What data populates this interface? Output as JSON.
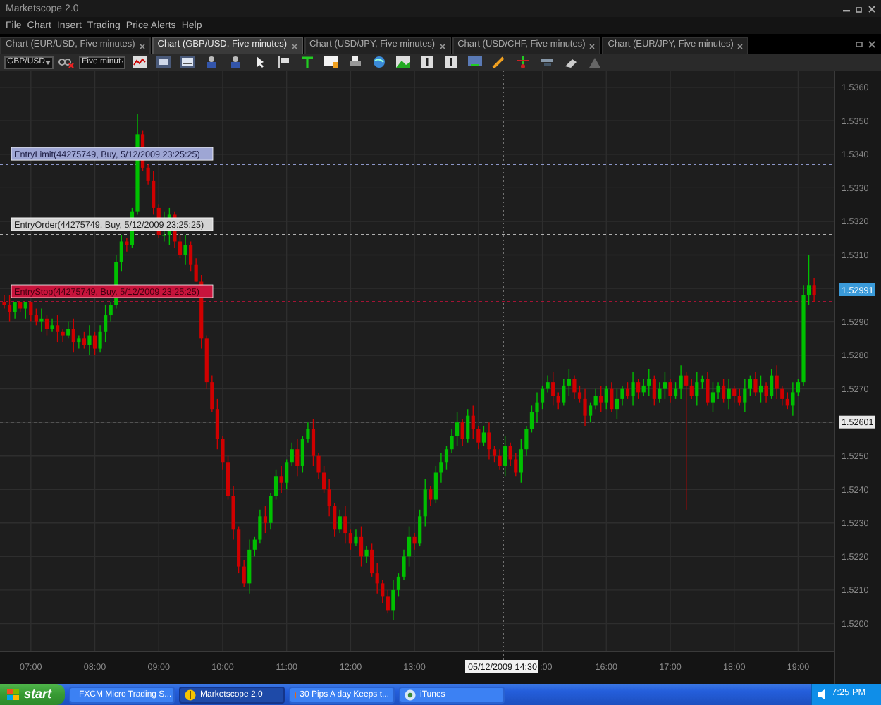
{
  "window": {
    "title": "Marketscope 2.0"
  },
  "menu": [
    "File",
    "Chart",
    "Insert",
    "Trading",
    "Price Alerts",
    "Help"
  ],
  "tabs": [
    {
      "label": "Chart (EUR/USD, Five minutes)",
      "selected": false
    },
    {
      "label": "Chart (GBP/USD, Five minutes)",
      "selected": true
    },
    {
      "label": "Chart (USD/JPY, Five minutes)",
      "selected": false
    },
    {
      "label": "Chart (USD/CHF, Five minutes)",
      "selected": false
    },
    {
      "label": "Chart (EUR/JPY, Five minutes)",
      "selected": false
    }
  ],
  "toolbar": {
    "symbol": "GBP/USD",
    "timeframe": "Five minut"
  },
  "chart": {
    "time_fragment": ":00",
    "orders": [
      {
        "kind": "limit",
        "label": "EntryLimit(44275749, Buy, 5/12/2009 23:25:25)"
      },
      {
        "kind": "order",
        "label": "EntryOrder(44275749, Buy, 5/12/2009 23:25:25)"
      },
      {
        "kind": "stop",
        "label": "EntryStop(44275749, Buy, 5/12/2009 23:25:25)"
      }
    ],
    "chart_data": {
      "type": "candlestick",
      "grid": true,
      "ylim": [
        1.5182,
        1.5365
      ],
      "ref_lines": [
        {
          "axis": "y",
          "value": 1.5337,
          "color": "#8c96c8"
        },
        {
          "axis": "y",
          "value": 1.5316,
          "color": "#e0e0e0"
        },
        {
          "axis": "y",
          "value": 1.5296,
          "color": "#d0103c"
        },
        {
          "axis": "y",
          "value": 1.52601,
          "color": "#777777",
          "label": "1.52601"
        }
      ],
      "yticks": [
        {
          "value": 1.536,
          "label": "1.5360"
        },
        {
          "value": 1.535,
          "label": "1.5350"
        },
        {
          "value": 1.534,
          "label": "1.5340"
        },
        {
          "value": 1.533,
          "label": "1.5330"
        },
        {
          "value": 1.532,
          "label": "1.5320"
        },
        {
          "value": 1.531,
          "label": "1.5310"
        },
        {
          "value": 1.529,
          "label": "1.5290"
        },
        {
          "value": 1.528,
          "label": "1.5280"
        },
        {
          "value": 1.527,
          "label": "1.5270"
        },
        {
          "value": 1.525,
          "label": "1.5250"
        },
        {
          "value": 1.524,
          "label": "1.5240"
        },
        {
          "value": 1.523,
          "label": "1.5230"
        },
        {
          "value": 1.522,
          "label": "1.5220"
        },
        {
          "value": 1.521,
          "label": "1.5210"
        },
        {
          "value": 1.52,
          "label": "1.5200"
        }
      ],
      "categories": [
        null,
        null,
        null,
        null,
        null,
        "07:00",
        null,
        null,
        null,
        null,
        null,
        null,
        null,
        null,
        null,
        null,
        null,
        "08:00",
        null,
        null,
        null,
        null,
        null,
        null,
        null,
        null,
        null,
        null,
        null,
        "09:00",
        null,
        null,
        null,
        null,
        null,
        null,
        null,
        null,
        null,
        null,
        null,
        "10:00",
        null,
        null,
        null,
        null,
        null,
        null,
        null,
        null,
        null,
        null,
        null,
        "11:00",
        null,
        null,
        null,
        null,
        null,
        null,
        null,
        null,
        null,
        null,
        null,
        "12:00",
        null,
        null,
        null,
        null,
        null,
        null,
        null,
        null,
        null,
        null,
        null,
        "13:00",
        null,
        null,
        null,
        null,
        null,
        null,
        null,
        null,
        null,
        null,
        null,
        null,
        null,
        null,
        null,
        null,
        null,
        null,
        null,
        null,
        null,
        null,
        null,
        null,
        null,
        null,
        null,
        null,
        null,
        null,
        null,
        null,
        null,
        null,
        null,
        "16:00",
        null,
        null,
        null,
        null,
        null,
        null,
        null,
        null,
        null,
        null,
        null,
        "17:00",
        null,
        null,
        null,
        null,
        null,
        null,
        null,
        null,
        null,
        null,
        null,
        "18:00",
        null,
        null,
        null,
        null,
        null,
        null,
        null,
        null,
        null,
        null,
        null,
        "19:00",
        null,
        null,
        null
      ],
      "ohlc": [
        [
          1.5296,
          1.5298,
          1.5294,
          1.5295
        ],
        [
          1.5295,
          1.5298,
          1.529,
          1.5293
        ],
        [
          1.5293,
          1.5296,
          1.5291,
          1.5296
        ],
        [
          1.5296,
          1.5296,
          1.5293,
          1.5294
        ],
        [
          1.5294,
          1.5296,
          1.5291,
          1.5296
        ],
        [
          1.5296,
          1.5296,
          1.529,
          1.5292
        ],
        [
          1.5292,
          1.5294,
          1.5289,
          1.529
        ],
        [
          1.529,
          1.5294,
          1.5287,
          1.5291
        ],
        [
          1.5291,
          1.5292,
          1.5286,
          1.5288
        ],
        [
          1.5288,
          1.5291,
          1.5287,
          1.5289
        ],
        [
          1.5289,
          1.5292,
          1.5284,
          1.5287
        ],
        [
          1.5287,
          1.5288,
          1.5284,
          1.5286
        ],
        [
          1.5286,
          1.529,
          1.5285,
          1.5288
        ],
        [
          1.5288,
          1.5291,
          1.5281,
          1.5284
        ],
        [
          1.5284,
          1.5286,
          1.5282,
          1.5285
        ],
        [
          1.5285,
          1.5287,
          1.5282,
          1.5283
        ],
        [
          1.5283,
          1.5289,
          1.528,
          1.5286
        ],
        [
          1.5286,
          1.5287,
          1.528,
          1.5282
        ],
        [
          1.5282,
          1.5289,
          1.5281,
          1.5287
        ],
        [
          1.5287,
          1.5295,
          1.5284,
          1.5292
        ],
        [
          1.5292,
          1.5296,
          1.529,
          1.5295
        ],
        [
          1.5295,
          1.531,
          1.5294,
          1.5308
        ],
        [
          1.5308,
          1.5316,
          1.5305,
          1.5314
        ],
        [
          1.5314,
          1.5315,
          1.5311,
          1.5313
        ],
        [
          1.5313,
          1.5324,
          1.5312,
          1.5323
        ],
        [
          1.5323,
          1.5352,
          1.5322,
          1.5346
        ],
        [
          1.5346,
          1.5347,
          1.5335,
          1.5336
        ],
        [
          1.5336,
          1.5337,
          1.5331,
          1.5332
        ],
        [
          1.5332,
          1.5335,
          1.5322,
          1.5324
        ],
        [
          1.5324,
          1.5325,
          1.5315,
          1.5316
        ],
        [
          1.5316,
          1.5323,
          1.5314,
          1.5316
        ],
        [
          1.5316,
          1.5324,
          1.5313,
          1.5322
        ],
        [
          1.5322,
          1.5323,
          1.5312,
          1.5314
        ],
        [
          1.5314,
          1.5316,
          1.5309,
          1.531
        ],
        [
          1.531,
          1.5316,
          1.5307,
          1.5313
        ],
        [
          1.5313,
          1.5314,
          1.5305,
          1.5307
        ],
        [
          1.5307,
          1.5309,
          1.5302,
          1.5302
        ],
        [
          1.5302,
          1.5304,
          1.5282,
          1.5285
        ],
        [
          1.5285,
          1.5286,
          1.527,
          1.5272
        ],
        [
          1.5272,
          1.5274,
          1.5263,
          1.5264
        ],
        [
          1.5264,
          1.5267,
          1.5252,
          1.5255
        ],
        [
          1.5255,
          1.5256,
          1.5246,
          1.5248
        ],
        [
          1.5248,
          1.525,
          1.5237,
          1.5238
        ],
        [
          1.5238,
          1.5241,
          1.5225,
          1.5228
        ],
        [
          1.5228,
          1.5229,
          1.5215,
          1.5217
        ],
        [
          1.5217,
          1.5219,
          1.5211,
          1.5212
        ],
        [
          1.5212,
          1.5225,
          1.5209,
          1.5222
        ],
        [
          1.5222,
          1.5226,
          1.522,
          1.5225
        ],
        [
          1.5225,
          1.5234,
          1.5224,
          1.5232
        ],
        [
          1.5232,
          1.5235,
          1.5227,
          1.523
        ],
        [
          1.523,
          1.5239,
          1.5228,
          1.5238
        ],
        [
          1.5238,
          1.5246,
          1.5237,
          1.5244
        ],
        [
          1.5244,
          1.5247,
          1.5239,
          1.5242
        ],
        [
          1.5242,
          1.5249,
          1.524,
          1.5248
        ],
        [
          1.5248,
          1.5254,
          1.5247,
          1.5252
        ],
        [
          1.5252,
          1.5255,
          1.5244,
          1.5247
        ],
        [
          1.5247,
          1.5256,
          1.5245,
          1.5255
        ],
        [
          1.5255,
          1.526,
          1.5254,
          1.5258
        ],
        [
          1.5258,
          1.5261,
          1.5247,
          1.525
        ],
        [
          1.525,
          1.5251,
          1.5243,
          1.5245
        ],
        [
          1.5245,
          1.5247,
          1.5239,
          1.524
        ],
        [
          1.524,
          1.5243,
          1.5232,
          1.5235
        ],
        [
          1.5235,
          1.5236,
          1.5226,
          1.5228
        ],
        [
          1.5228,
          1.5234,
          1.5227,
          1.5232
        ],
        [
          1.5232,
          1.5235,
          1.5224,
          1.5227
        ],
        [
          1.5227,
          1.5228,
          1.5222,
          1.5224
        ],
        [
          1.5224,
          1.5228,
          1.5223,
          1.5226
        ],
        [
          1.5226,
          1.5229,
          1.5217,
          1.522
        ],
        [
          1.522,
          1.5223,
          1.5218,
          1.5222
        ],
        [
          1.5222,
          1.5224,
          1.5214,
          1.5215
        ],
        [
          1.5215,
          1.5218,
          1.5209,
          1.5212
        ],
        [
          1.5212,
          1.5213,
          1.5206,
          1.5208
        ],
        [
          1.5208,
          1.521,
          1.5203,
          1.5204
        ],
        [
          1.5204,
          1.5213,
          1.5201,
          1.521
        ],
        [
          1.521,
          1.5215,
          1.5208,
          1.5214
        ],
        [
          1.5214,
          1.5222,
          1.5213,
          1.522
        ],
        [
          1.522,
          1.5229,
          1.5217,
          1.5226
        ],
        [
          1.5226,
          1.5227,
          1.5222,
          1.5224
        ],
        [
          1.5224,
          1.5234,
          1.5223,
          1.5232
        ],
        [
          1.5232,
          1.5243,
          1.5229,
          1.524
        ],
        [
          1.524,
          1.5241,
          1.5235,
          1.5237
        ],
        [
          1.5237,
          1.5247,
          1.5236,
          1.5245
        ],
        [
          1.5245,
          1.5251,
          1.5242,
          1.5248
        ],
        [
          1.5248,
          1.5253,
          1.5246,
          1.5252
        ],
        [
          1.5252,
          1.5258,
          1.5251,
          1.5256
        ],
        [
          1.5256,
          1.5263,
          1.5253,
          1.526
        ],
        [
          1.526,
          1.5261,
          1.5253,
          1.5255
        ],
        [
          1.5255,
          1.5264,
          1.5254,
          1.5262
        ],
        [
          1.5262,
          1.5265,
          1.5255,
          1.5258
        ],
        [
          1.5258,
          1.5259,
          1.5252,
          1.5254
        ],
        [
          1.5254,
          1.5259,
          1.5253,
          1.5257
        ],
        [
          1.5257,
          1.526,
          1.5249,
          1.5252
        ],
        [
          1.5252,
          1.5253,
          1.5248,
          1.525
        ],
        [
          1.525,
          1.5252,
          1.5246,
          1.5247
        ],
        [
          1.5247,
          1.5256,
          1.5244,
          1.5253
        ],
        [
          1.5253,
          1.5254,
          1.5247,
          1.5249
        ],
        [
          1.5249,
          1.5251,
          1.5244,
          1.5245
        ],
        [
          1.5245,
          1.5255,
          1.5242,
          1.5252
        ],
        [
          1.5252,
          1.5259,
          1.525,
          1.5258
        ],
        [
          1.5258,
          1.5265,
          1.5257,
          1.5263
        ],
        [
          1.5263,
          1.5269,
          1.526,
          1.5266
        ],
        [
          1.5266,
          1.5271,
          1.5264,
          1.527
        ],
        [
          1.527,
          1.5274,
          1.5269,
          1.5272
        ],
        [
          1.5272,
          1.5275,
          1.5265,
          1.5268
        ],
        [
          1.5268,
          1.5269,
          1.5264,
          1.5266
        ],
        [
          1.5266,
          1.5273,
          1.5265,
          1.5271
        ],
        [
          1.5271,
          1.5276,
          1.5268,
          1.5273
        ],
        [
          1.5273,
          1.5274,
          1.5267,
          1.5269
        ],
        [
          1.5269,
          1.5271,
          1.5266,
          1.5267
        ],
        [
          1.5267,
          1.527,
          1.5259,
          1.5262
        ],
        [
          1.5262,
          1.5266,
          1.526,
          1.5265
        ],
        [
          1.5265,
          1.527,
          1.5264,
          1.5268
        ],
        [
          1.5268,
          1.5271,
          1.5263,
          1.5266
        ],
        [
          1.5266,
          1.5271,
          1.5264,
          1.527
        ],
        [
          1.527,
          1.5272,
          1.5263,
          1.5264
        ],
        [
          1.5264,
          1.527,
          1.5261,
          1.5267
        ],
        [
          1.5267,
          1.5271,
          1.5265,
          1.527
        ],
        [
          1.527,
          1.5272,
          1.5267,
          1.5268
        ],
        [
          1.5268,
          1.5275,
          1.5265,
          1.5272
        ],
        [
          1.5272,
          1.5273,
          1.5267,
          1.5269
        ],
        [
          1.5269,
          1.5273,
          1.5268,
          1.5271
        ],
        [
          1.5271,
          1.5276,
          1.5268,
          1.5273
        ],
        [
          1.5273,
          1.5274,
          1.5265,
          1.5267
        ],
        [
          1.5267,
          1.5272,
          1.5266,
          1.527
        ],
        [
          1.527,
          1.5275,
          1.5267,
          1.5272
        ],
        [
          1.5272,
          1.5273,
          1.5266,
          1.5268
        ],
        [
          1.5268,
          1.5272,
          1.5267,
          1.527
        ],
        [
          1.527,
          1.5277,
          1.5267,
          1.5274
        ],
        [
          1.5274,
          1.5275,
          1.5234,
          1.5271
        ],
        [
          1.5271,
          1.5273,
          1.5267,
          1.5268
        ],
        [
          1.5268,
          1.5275,
          1.5265,
          1.5272
        ],
        [
          1.5272,
          1.5274,
          1.527,
          1.5273
        ],
        [
          1.5273,
          1.5275,
          1.5265,
          1.5266
        ],
        [
          1.5266,
          1.5272,
          1.5263,
          1.5269
        ],
        [
          1.5269,
          1.5272,
          1.5267,
          1.5271
        ],
        [
          1.5271,
          1.5273,
          1.5266,
          1.5267
        ],
        [
          1.5267,
          1.5273,
          1.5264,
          1.527
        ],
        [
          1.527,
          1.5271,
          1.5266,
          1.5268
        ],
        [
          1.5268,
          1.527,
          1.5265,
          1.5266
        ],
        [
          1.5266,
          1.5273,
          1.5263,
          1.527
        ],
        [
          1.527,
          1.5274,
          1.5268,
          1.5273
        ],
        [
          1.5273,
          1.5275,
          1.5268,
          1.5269
        ],
        [
          1.5269,
          1.5274,
          1.5266,
          1.5271
        ],
        [
          1.5271,
          1.5272,
          1.5266,
          1.5268
        ],
        [
          1.5268,
          1.5276,
          1.5267,
          1.5274
        ],
        [
          1.5274,
          1.5277,
          1.5267,
          1.527
        ],
        [
          1.527,
          1.5271,
          1.5265,
          1.5267
        ],
        [
          1.5267,
          1.5269,
          1.5264,
          1.5265
        ],
        [
          1.5265,
          1.5272,
          1.5262,
          1.5269
        ],
        [
          1.5269,
          1.5273,
          1.5268,
          1.5272
        ],
        [
          1.5272,
          1.5301,
          1.5271,
          1.5298
        ],
        [
          1.5298,
          1.531,
          1.5295,
          1.5301
        ],
        [
          1.5301,
          1.5303,
          1.5296,
          1.5298
        ]
      ]
    },
    "current_price": "1.52991",
    "crosshair_time": "05/12/2009 14:30"
  },
  "taskbar": {
    "start": "start",
    "items": [
      {
        "label": "FXCM Micro Trading S...",
        "selected": false
      },
      {
        "label": "Marketscope 2.0",
        "selected": true
      },
      {
        "label": "30 Pips A day Keeps t...",
        "selected": false
      },
      {
        "label": "iTunes",
        "selected": false
      }
    ],
    "clock": "7:25 PM"
  }
}
